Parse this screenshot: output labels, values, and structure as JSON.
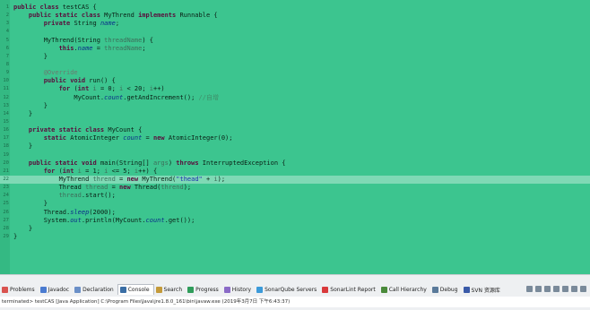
{
  "editor": {
    "lines": [
      {
        "n": "1",
        "segs": [
          [
            "kw",
            "public class "
          ],
          [
            "",
            "testCAS {"
          ]
        ]
      },
      {
        "n": "2",
        "segs": [
          [
            "",
            "    "
          ],
          [
            "kw",
            "public static class "
          ],
          [
            "",
            "MyThrend "
          ],
          [
            "kw",
            "implements "
          ],
          [
            "",
            "Runnable {"
          ]
        ]
      },
      {
        "n": "3",
        "segs": [
          [
            "",
            "        "
          ],
          [
            "kw",
            "private "
          ],
          [
            "",
            "String "
          ],
          [
            "fld",
            "name"
          ],
          [
            "",
            ";"
          ]
        ]
      },
      {
        "n": "4",
        "segs": []
      },
      {
        "n": "5",
        "segs": [
          [
            "",
            "        MyThrend(String "
          ],
          [
            "prm",
            "threadName"
          ],
          [
            "",
            ") {"
          ]
        ]
      },
      {
        "n": "6",
        "segs": [
          [
            "",
            "            "
          ],
          [
            "kw",
            "this"
          ],
          [
            "",
            "."
          ],
          [
            "fld",
            "name"
          ],
          [
            "",
            " = "
          ],
          [
            "prm",
            "threadName"
          ],
          [
            "",
            ";"
          ]
        ]
      },
      {
        "n": "7",
        "segs": [
          [
            "",
            "        }"
          ]
        ]
      },
      {
        "n": "8",
        "segs": []
      },
      {
        "n": "9",
        "segs": [
          [
            "",
            "        "
          ],
          [
            "ann",
            "@Override"
          ]
        ]
      },
      {
        "n": "10",
        "segs": [
          [
            "",
            "        "
          ],
          [
            "kw",
            "public void "
          ],
          [
            "",
            "run() {"
          ]
        ]
      },
      {
        "n": "11",
        "segs": [
          [
            "",
            "            "
          ],
          [
            "kw",
            "for "
          ],
          [
            "",
            "("
          ],
          [
            "kw",
            "int "
          ],
          [
            "prm",
            "i"
          ],
          [
            "",
            " = 0; "
          ],
          [
            "prm",
            "i"
          ],
          [
            "",
            " < 20; "
          ],
          [
            "prm",
            "i"
          ],
          [
            "",
            "++)"
          ]
        ]
      },
      {
        "n": "12",
        "segs": [
          [
            "",
            "                MyCount."
          ],
          [
            "fld",
            "count"
          ],
          [
            "",
            ".getAndIncrement(); "
          ],
          [
            "cmt",
            "//自增"
          ]
        ]
      },
      {
        "n": "13",
        "segs": [
          [
            "",
            "        }"
          ]
        ]
      },
      {
        "n": "14",
        "segs": [
          [
            "",
            "    }"
          ]
        ]
      },
      {
        "n": "15",
        "segs": []
      },
      {
        "n": "16",
        "segs": [
          [
            "",
            "    "
          ],
          [
            "kw",
            "private static class "
          ],
          [
            "",
            "MyCount {"
          ]
        ]
      },
      {
        "n": "17",
        "segs": [
          [
            "",
            "        "
          ],
          [
            "kw",
            "static "
          ],
          [
            "",
            "AtomicInteger "
          ],
          [
            "fld",
            "count"
          ],
          [
            "",
            " = "
          ],
          [
            "kw",
            "new "
          ],
          [
            "",
            "AtomicInteger(0);"
          ]
        ]
      },
      {
        "n": "18",
        "segs": [
          [
            "",
            "    }"
          ]
        ]
      },
      {
        "n": "19",
        "segs": []
      },
      {
        "n": "20",
        "segs": [
          [
            "",
            "    "
          ],
          [
            "kw",
            "public static void "
          ],
          [
            "",
            "main(String[] "
          ],
          [
            "prm",
            "args"
          ],
          [
            "",
            ") "
          ],
          [
            "kw",
            "throws "
          ],
          [
            "",
            "InterruptedException {"
          ]
        ]
      },
      {
        "n": "21",
        "segs": [
          [
            "",
            "        "
          ],
          [
            "kw",
            "for "
          ],
          [
            "",
            "("
          ],
          [
            "kw",
            "int "
          ],
          [
            "prm",
            "i"
          ],
          [
            "",
            " = 1; "
          ],
          [
            "prm",
            "i"
          ],
          [
            "",
            " <= 5; "
          ],
          [
            "prm",
            "i"
          ],
          [
            "",
            "++) {"
          ]
        ]
      },
      {
        "n": "22",
        "hl": true,
        "segs": [
          [
            "",
            "            MyThrend "
          ],
          [
            "prm",
            "thrend"
          ],
          [
            "",
            " = "
          ],
          [
            "kw",
            "new "
          ],
          [
            "",
            "MyThrend("
          ],
          [
            "str",
            "\"thead\""
          ],
          [
            "",
            " + "
          ],
          [
            "prm",
            "i"
          ],
          [
            "",
            ");"
          ]
        ]
      },
      {
        "n": "23",
        "segs": [
          [
            "",
            "            Thread "
          ],
          [
            "prm",
            "thread"
          ],
          [
            "",
            " = "
          ],
          [
            "kw",
            "new "
          ],
          [
            "",
            "Thread("
          ],
          [
            "prm",
            "thrend"
          ],
          [
            "",
            ");"
          ]
        ]
      },
      {
        "n": "24",
        "segs": [
          [
            "",
            "            "
          ],
          [
            "prm",
            "thread"
          ],
          [
            "",
            ".start();"
          ]
        ]
      },
      {
        "n": "25",
        "segs": [
          [
            "",
            "        }"
          ]
        ]
      },
      {
        "n": "26",
        "segs": [
          [
            "",
            "        Thread."
          ],
          [
            "fld",
            "sleep"
          ],
          [
            "",
            "(2000);"
          ]
        ]
      },
      {
        "n": "27",
        "segs": [
          [
            "",
            "        System."
          ],
          [
            "fld",
            "out"
          ],
          [
            "",
            ".println(MyCount."
          ],
          [
            "fld",
            "count"
          ],
          [
            "",
            ".get());"
          ]
        ]
      },
      {
        "n": "28",
        "segs": [
          [
            "",
            "    }"
          ]
        ]
      },
      {
        "n": "29",
        "segs": [
          [
            "",
            "}"
          ]
        ]
      }
    ]
  },
  "panel": {
    "tabs": [
      {
        "label": "Problems",
        "icon": "problems-icon",
        "color": "#d9534f"
      },
      {
        "label": "Javadoc",
        "icon": "javadoc-icon",
        "color": "#4a7bd0"
      },
      {
        "label": "Declaration",
        "icon": "declaration-icon",
        "color": "#6a8fc7"
      },
      {
        "label": "Console",
        "icon": "console-icon",
        "color": "#3a6ea5",
        "active": true
      },
      {
        "label": "Search",
        "icon": "search-icon",
        "color": "#c49a3a"
      },
      {
        "label": "Progress",
        "icon": "progress-icon",
        "color": "#2f9c5a"
      },
      {
        "label": "History",
        "icon": "history-icon",
        "color": "#8a6ac7"
      },
      {
        "label": "SonarQube Servers",
        "icon": "sonarqube-icon",
        "color": "#3b9ad9"
      },
      {
        "label": "SonarLint Report",
        "icon": "sonarlint-icon",
        "color": "#d9393b"
      },
      {
        "label": "Call Hierarchy",
        "icon": "call-hierarchy-icon",
        "color": "#4a8a3a"
      },
      {
        "label": "Debug",
        "icon": "debug-icon",
        "color": "#5a7a9a"
      },
      {
        "label": "SVN 资源库",
        "icon": "svn-icon",
        "color": "#3a5aa8"
      }
    ],
    "status": "terminated> testCAS [Java Application] C:\\Program Files\\Java\\jre1.8.0_161\\bin\\javaw.exe (2019年3月7日 下午6:43:37)"
  },
  "colors": {
    "editor_bg": "#3cc58f",
    "highlight": "#7fd9b5",
    "panel_bg": "#eef0f2"
  }
}
